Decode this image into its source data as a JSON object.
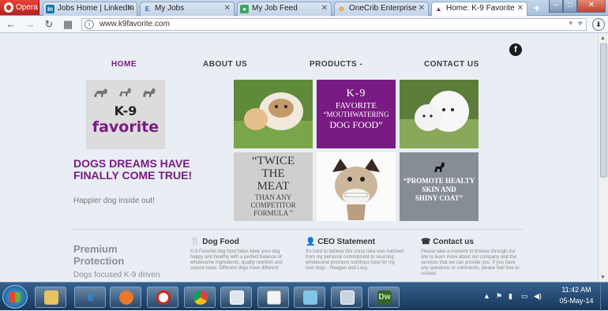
{
  "browser": {
    "menu_label": "Opera",
    "tabs": [
      {
        "label": "Jobs Home | LinkedIn",
        "icon": "linkedin-icon"
      },
      {
        "label": "My Jobs",
        "icon": "e-icon"
      },
      {
        "label": "My Job Feed",
        "icon": "location-pin-icon"
      },
      {
        "label": "OneCrib Enterprise",
        "icon": "flower-icon"
      },
      {
        "label": "Home: K-9 Favorite",
        "icon": "dog-icon"
      }
    ],
    "url": "www.k9favorite.com"
  },
  "site": {
    "nav": [
      "HOME",
      "ABOUT US",
      "PRODUCTS -",
      "CONTACT US"
    ],
    "logo": {
      "line1": "K-9",
      "line2": "favorite"
    },
    "tagline": "DOGS DREAMS HAVE FINALLY COME TRUE!",
    "subtagline": "Happier dog inside out!",
    "tiles": {
      "k9": [
        "K-9",
        "FAVORITE",
        "“MOUTHWATERING",
        "DOG FOOD”"
      ],
      "twice": [
        "“TWICE",
        "THE",
        "MEAT",
        "THAN ANY",
        "COMPETITOR",
        "FORMULA ”"
      ],
      "promote": [
        "“PROMOTE HEALTY",
        "SKIN AND",
        "SHINY COAT”"
      ]
    },
    "premium_title": "Premium Protection",
    "premium_sub": "Dogs focused K-9 driven",
    "columns": [
      {
        "heading": "Dog Food",
        "icon": "fork-knife-icon",
        "text": "K-9 Favorite dog food helps keep your dog happy and healthy with a perfect balance of wholesome ingredients, quality nutrition and superb taste. Different dogs have different"
      },
      {
        "heading": "CEO Statement",
        "icon": "person-icon",
        "text": "It's hard to believe this crazy idea was hatched from my personal commitment to sourcing wholesome premium nutritious food for my own dogs - Reagan and Lucy."
      },
      {
        "heading": "Contact us",
        "icon": "phone-icon",
        "text": "Please take a moment to browse through our site to learn more about our company and the services that we can provide you. If you have any questions or comments, please feel free to contact"
      }
    ]
  },
  "taskbar": {
    "clock_time": "11:42 AM",
    "clock_date": "05-May-14"
  },
  "colors": {
    "brand": "#7a1a84",
    "promote_tile": "#868d95"
  }
}
